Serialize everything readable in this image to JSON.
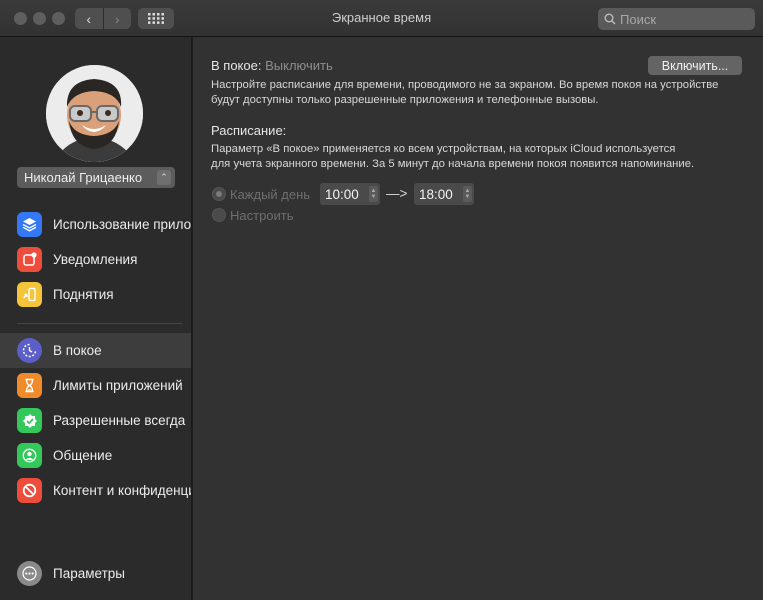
{
  "window": {
    "title": "Экранное время",
    "search_placeholder": "Поиск"
  },
  "sidebar": {
    "user_name": "Николай Грицаенко",
    "items": [
      {
        "label": "Использование приложений",
        "icon": "layers-icon",
        "color": "#3478f6"
      },
      {
        "label": "Уведомления",
        "icon": "notification-icon",
        "color": "#ef4d3b"
      },
      {
        "label": "Поднятия",
        "icon": "pickup-icon",
        "color": "#f6c43b"
      },
      {
        "label": "В покое",
        "icon": "downtime-icon",
        "color": "#5b5fc7",
        "selected": true
      },
      {
        "label": "Лимиты приложений",
        "icon": "hourglass-icon",
        "color": "#f08b2c"
      },
      {
        "label": "Разрешенные всегда",
        "icon": "checkmark-badge-icon",
        "color": "#34c759"
      },
      {
        "label": "Общение",
        "icon": "contact-icon",
        "color": "#34c759"
      },
      {
        "label": "Контент и конфиденциальность",
        "icon": "restricted-icon",
        "color": "#ef4d3b"
      }
    ],
    "options_label": "Параметры"
  },
  "main": {
    "downtime_label": "В покое:",
    "downtime_status": "Выключить",
    "enable_button": "Включить...",
    "downtime_description_1": "Настройте расписание для времени, проводимого не за экраном. Во время покоя на устройстве",
    "downtime_description_2": "будут доступны только разрешенные приложения и телефонные вызовы.",
    "schedule_label": "Расписание:",
    "schedule_description_1": "Параметр «В покое» применяется ко всем устройствам, на которых iCloud используется",
    "schedule_description_2": "для учета экранного времени. За 5 минут до начала времени покоя появится напоминание.",
    "every_day_label": "Каждый день",
    "start_time": "10:00",
    "arrow": "—>",
    "end_time": "18:00",
    "custom_label": "Настроить"
  }
}
